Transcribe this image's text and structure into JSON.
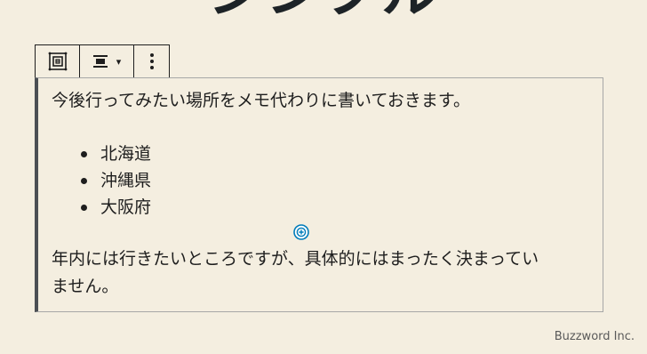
{
  "header": {
    "title": "シンプル"
  },
  "toolbar": {
    "transform_icon": "block-transform-icon",
    "align_icon": "align-center-icon",
    "align_arrow": "▾",
    "more_icon": "more-options-icon"
  },
  "block": {
    "paragraph_1": "今後行ってみたい場所をメモ代わりに書いておきます。",
    "list_items": [
      "北海道",
      "沖縄県",
      "大阪府"
    ],
    "inserter_icon": "add-block-icon",
    "paragraph_2_line_1": "年内には行きたいところですが、具体的にはまったく決まってい",
    "paragraph_2_line_2": "ません。"
  },
  "footer": {
    "credit": "Buzzword Inc."
  },
  "colors": {
    "background": "#f4eee0",
    "text": "#1e1e1e",
    "accent": "#007cba",
    "block_left_border": "#4b4f54"
  }
}
